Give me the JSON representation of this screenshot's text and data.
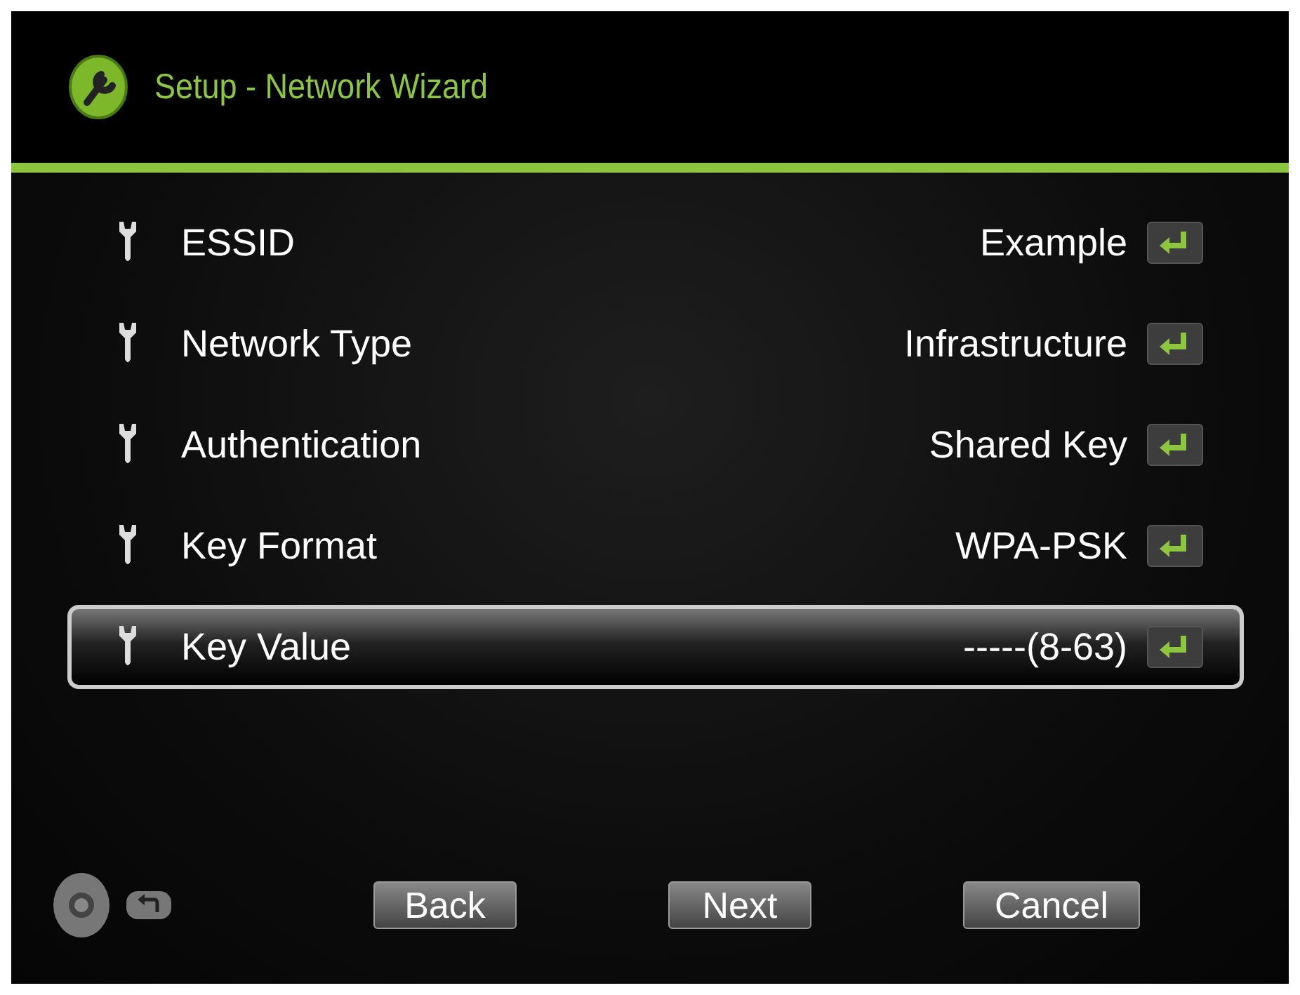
{
  "header": {
    "title": "Setup - Network Wizard"
  },
  "settings": [
    {
      "label": "ESSID",
      "value": "Example",
      "selected": false
    },
    {
      "label": "Network Type",
      "value": "Infrastructure",
      "selected": false
    },
    {
      "label": "Authentication",
      "value": "Shared Key",
      "selected": false
    },
    {
      "label": "Key Format",
      "value": "WPA-PSK",
      "selected": false
    },
    {
      "label": "Key Value",
      "value": "-----(8-63)",
      "selected": true
    }
  ],
  "buttons": [
    "Back",
    "Next",
    "Cancel"
  ]
}
